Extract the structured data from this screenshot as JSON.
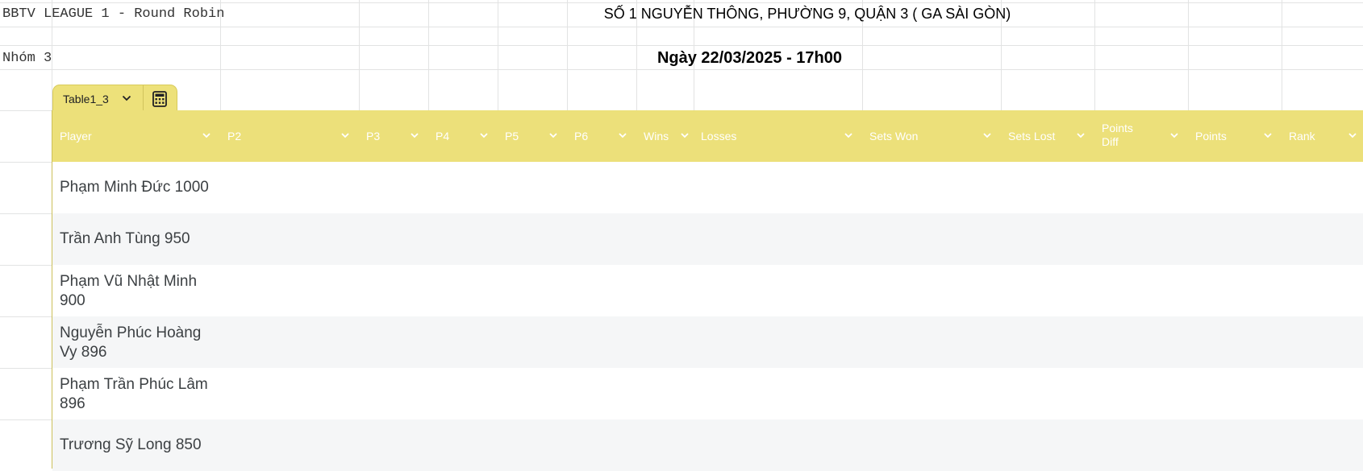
{
  "sheet": {
    "title": "BBTV LEAGUE 1 - Round Robin",
    "address": "SỐ 1 NGUYỄN THÔNG, PHƯỜNG 9, QUẬN 3 ( GA SÀI GÒN)",
    "group": "Nhóm 3",
    "date": "Ngày 22/03/2025 - 17h00"
  },
  "table": {
    "name": "Table1_3",
    "columns": [
      "Player",
      "P2",
      "P3",
      "P4",
      "P5",
      "P6",
      "Wins",
      "Losses",
      "Sets Won",
      "Sets Lost",
      "Points Diff",
      "Points",
      "Rank"
    ],
    "rows": [
      {
        "player": "Phạm Minh Đức 1000"
      },
      {
        "player": "Trần Anh Tùng 950"
      },
      {
        "player": "Phạm Vũ Nhật Minh 900"
      },
      {
        "player": "Nguyễn Phúc Hoàng Vy 896"
      },
      {
        "player": "Phạm Trần Phúc Lâm 896"
      },
      {
        "player": "Trương Sỹ Long 850"
      }
    ]
  },
  "colors": {
    "header_bg": "#ece07a",
    "header_text": "#ffffff",
    "row_alt": "#f5f6f7",
    "grid": "#e2e3e3"
  },
  "icons": {
    "tab_dropdown": "chevron-down-icon",
    "tab_tools": "calculator-icon",
    "column_menu": "chevron-down-icon"
  }
}
